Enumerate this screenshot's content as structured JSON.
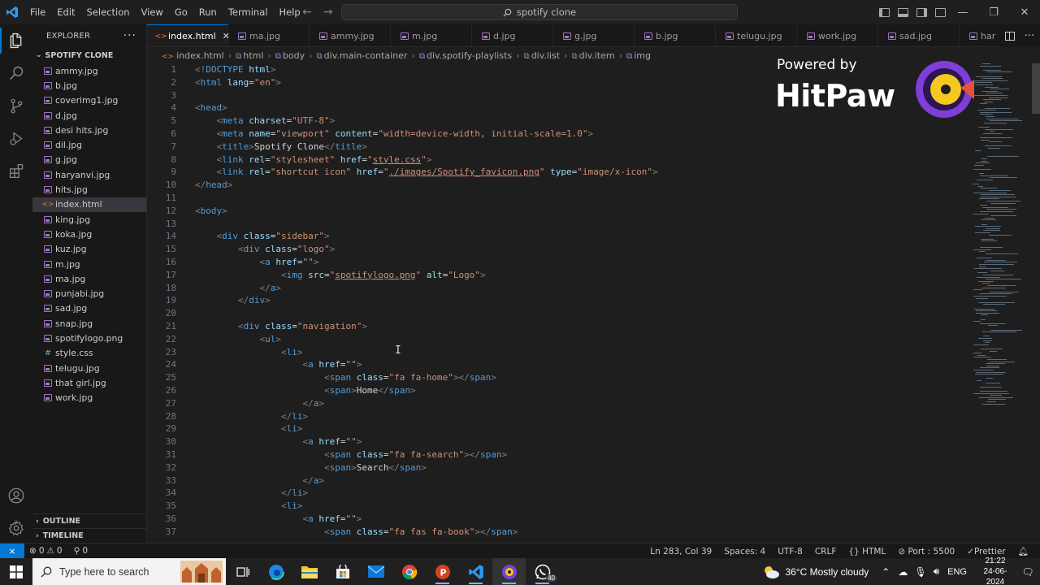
{
  "menu": [
    "File",
    "Edit",
    "Selection",
    "View",
    "Go",
    "Run",
    "Terminal",
    "Help"
  ],
  "command_center": "spotify clone",
  "explorer": {
    "title": "EXPLORER",
    "folder": "SPOTIFY CLONE",
    "files": [
      {
        "name": "ammy.jpg",
        "type": "img"
      },
      {
        "name": "b.jpg",
        "type": "img"
      },
      {
        "name": "coverimg1.jpg",
        "type": "img"
      },
      {
        "name": "d.jpg",
        "type": "img"
      },
      {
        "name": "desi hits.jpg",
        "type": "img"
      },
      {
        "name": "dil.jpg",
        "type": "img"
      },
      {
        "name": "g.jpg",
        "type": "img"
      },
      {
        "name": "haryanvi.jpg",
        "type": "img"
      },
      {
        "name": "hits.jpg",
        "type": "img"
      },
      {
        "name": "index.html",
        "type": "html",
        "active": true
      },
      {
        "name": "king.jpg",
        "type": "img"
      },
      {
        "name": "koka.jpg",
        "type": "img"
      },
      {
        "name": "kuz.jpg",
        "type": "img"
      },
      {
        "name": "m.jpg",
        "type": "img"
      },
      {
        "name": "ma.jpg",
        "type": "img"
      },
      {
        "name": "punjabi.jpg",
        "type": "img"
      },
      {
        "name": "sad.jpg",
        "type": "img"
      },
      {
        "name": "snap.jpg",
        "type": "img"
      },
      {
        "name": "spotifylogo.png",
        "type": "img"
      },
      {
        "name": "style.css",
        "type": "css"
      },
      {
        "name": "telugu.jpg",
        "type": "img"
      },
      {
        "name": "that girl.jpg",
        "type": "img"
      },
      {
        "name": "work.jpg",
        "type": "img"
      }
    ],
    "outline": "OUTLINE",
    "timeline": "TIMELINE"
  },
  "tabs": [
    {
      "name": "index.html",
      "type": "html",
      "active": true
    },
    {
      "name": "ma.jpg",
      "type": "img"
    },
    {
      "name": "ammy.jpg",
      "type": "img"
    },
    {
      "name": "m.jpg",
      "type": "img"
    },
    {
      "name": "d.jpg",
      "type": "img"
    },
    {
      "name": "g.jpg",
      "type": "img"
    },
    {
      "name": "b.jpg",
      "type": "img"
    },
    {
      "name": "telugu.jpg",
      "type": "img"
    },
    {
      "name": "work.jpg",
      "type": "img"
    },
    {
      "name": "sad.jpg",
      "type": "img"
    },
    {
      "name": "har",
      "type": "img"
    }
  ],
  "breadcrumb": [
    "index.html",
    "html",
    "body",
    "div.main-container",
    "div.spotify-playlists",
    "div.list",
    "div.item",
    "img"
  ],
  "code_lines": [
    [
      [
        "p",
        "<!"
      ],
      [
        "tag",
        "DOCTYPE"
      ],
      [
        "t",
        " "
      ],
      [
        "attr",
        "html"
      ],
      [
        "p",
        ">"
      ]
    ],
    [
      [
        "p",
        "<"
      ],
      [
        "tag",
        "html"
      ],
      [
        "t",
        " "
      ],
      [
        "attr",
        "lang"
      ],
      [
        "t",
        "="
      ],
      [
        "str",
        "\"en\""
      ],
      [
        "p",
        ">"
      ]
    ],
    [],
    [
      [
        "p",
        "<"
      ],
      [
        "tag",
        "head"
      ],
      [
        "p",
        ">"
      ]
    ],
    [
      [
        "t",
        "    "
      ],
      [
        "p",
        "<"
      ],
      [
        "tag",
        "meta"
      ],
      [
        "t",
        " "
      ],
      [
        "attr",
        "charset"
      ],
      [
        "t",
        "="
      ],
      [
        "str",
        "\"UTF-8\""
      ],
      [
        "p",
        ">"
      ]
    ],
    [
      [
        "t",
        "    "
      ],
      [
        "p",
        "<"
      ],
      [
        "tag",
        "meta"
      ],
      [
        "t",
        " "
      ],
      [
        "attr",
        "name"
      ],
      [
        "t",
        "="
      ],
      [
        "str",
        "\"viewport\""
      ],
      [
        "t",
        " "
      ],
      [
        "attr",
        "content"
      ],
      [
        "t",
        "="
      ],
      [
        "str",
        "\"width=device-width, initial-scale=1.0\""
      ],
      [
        "p",
        ">"
      ]
    ],
    [
      [
        "t",
        "    "
      ],
      [
        "p",
        "<"
      ],
      [
        "tag",
        "title"
      ],
      [
        "p",
        ">"
      ],
      [
        "t",
        "Spotify Clone"
      ],
      [
        "p",
        "</"
      ],
      [
        "tag",
        "title"
      ],
      [
        "p",
        ">"
      ]
    ],
    [
      [
        "t",
        "    "
      ],
      [
        "p",
        "<"
      ],
      [
        "tag",
        "link"
      ],
      [
        "t",
        " "
      ],
      [
        "attr",
        "rel"
      ],
      [
        "t",
        "="
      ],
      [
        "str",
        "\"stylesheet\""
      ],
      [
        "t",
        " "
      ],
      [
        "attr",
        "href"
      ],
      [
        "t",
        "="
      ],
      [
        "str",
        "\""
      ],
      [
        "strl",
        "style.css"
      ],
      [
        "str",
        "\""
      ],
      [
        "p",
        ">"
      ]
    ],
    [
      [
        "t",
        "    "
      ],
      [
        "p",
        "<"
      ],
      [
        "tag",
        "link"
      ],
      [
        "t",
        " "
      ],
      [
        "attr",
        "rel"
      ],
      [
        "t",
        "="
      ],
      [
        "str",
        "\"shortcut icon\""
      ],
      [
        "t",
        " "
      ],
      [
        "attr",
        "href"
      ],
      [
        "t",
        "="
      ],
      [
        "str",
        "\""
      ],
      [
        "strl",
        "./images/Spotify_favicon.png"
      ],
      [
        "str",
        "\""
      ],
      [
        "t",
        " "
      ],
      [
        "attr",
        "type"
      ],
      [
        "t",
        "="
      ],
      [
        "str",
        "\"image/x-icon\""
      ],
      [
        "p",
        ">"
      ]
    ],
    [
      [
        "p",
        "</"
      ],
      [
        "tag",
        "head"
      ],
      [
        "p",
        ">"
      ]
    ],
    [],
    [
      [
        "p",
        "<"
      ],
      [
        "tag",
        "body"
      ],
      [
        "p",
        ">"
      ]
    ],
    [],
    [
      [
        "t",
        "    "
      ],
      [
        "p",
        "<"
      ],
      [
        "tag",
        "div"
      ],
      [
        "t",
        " "
      ],
      [
        "attr",
        "class"
      ],
      [
        "t",
        "="
      ],
      [
        "str",
        "\"sidebar\""
      ],
      [
        "p",
        ">"
      ]
    ],
    [
      [
        "t",
        "        "
      ],
      [
        "p",
        "<"
      ],
      [
        "tag",
        "div"
      ],
      [
        "t",
        " "
      ],
      [
        "attr",
        "class"
      ],
      [
        "t",
        "="
      ],
      [
        "str",
        "\"logo\""
      ],
      [
        "p",
        ">"
      ]
    ],
    [
      [
        "t",
        "            "
      ],
      [
        "p",
        "<"
      ],
      [
        "tag",
        "a"
      ],
      [
        "t",
        " "
      ],
      [
        "attr",
        "href"
      ],
      [
        "t",
        "="
      ],
      [
        "str",
        "\"\""
      ],
      [
        "p",
        ">"
      ]
    ],
    [
      [
        "t",
        "                "
      ],
      [
        "p",
        "<"
      ],
      [
        "tag",
        "img"
      ],
      [
        "t",
        " "
      ],
      [
        "attr",
        "src"
      ],
      [
        "t",
        "="
      ],
      [
        "str",
        "\""
      ],
      [
        "strl",
        "spotifylogo.png"
      ],
      [
        "str",
        "\""
      ],
      [
        "t",
        " "
      ],
      [
        "attr",
        "alt"
      ],
      [
        "t",
        "="
      ],
      [
        "str",
        "\"Logo\""
      ],
      [
        "p",
        ">"
      ]
    ],
    [
      [
        "t",
        "            "
      ],
      [
        "p",
        "</"
      ],
      [
        "tag",
        "a"
      ],
      [
        "p",
        ">"
      ]
    ],
    [
      [
        "t",
        "        "
      ],
      [
        "p",
        "</"
      ],
      [
        "tag",
        "div"
      ],
      [
        "p",
        ">"
      ]
    ],
    [],
    [
      [
        "t",
        "        "
      ],
      [
        "p",
        "<"
      ],
      [
        "tag",
        "div"
      ],
      [
        "t",
        " "
      ],
      [
        "attr",
        "class"
      ],
      [
        "t",
        "="
      ],
      [
        "str",
        "\"navigation\""
      ],
      [
        "p",
        ">"
      ]
    ],
    [
      [
        "t",
        "            "
      ],
      [
        "p",
        "<"
      ],
      [
        "tag",
        "ul"
      ],
      [
        "p",
        ">"
      ]
    ],
    [
      [
        "t",
        "                "
      ],
      [
        "p",
        "<"
      ],
      [
        "tag",
        "li"
      ],
      [
        "p",
        ">"
      ]
    ],
    [
      [
        "t",
        "                    "
      ],
      [
        "p",
        "<"
      ],
      [
        "tag",
        "a"
      ],
      [
        "t",
        " "
      ],
      [
        "attr",
        "href"
      ],
      [
        "t",
        "="
      ],
      [
        "str",
        "\"\""
      ],
      [
        "p",
        ">"
      ]
    ],
    [
      [
        "t",
        "                        "
      ],
      [
        "p",
        "<"
      ],
      [
        "tag",
        "span"
      ],
      [
        "t",
        " "
      ],
      [
        "attr",
        "class"
      ],
      [
        "t",
        "="
      ],
      [
        "str",
        "\"fa fa-home\""
      ],
      [
        "p",
        "></"
      ],
      [
        "tag",
        "span"
      ],
      [
        "p",
        ">"
      ]
    ],
    [
      [
        "t",
        "                        "
      ],
      [
        "p",
        "<"
      ],
      [
        "tag",
        "span"
      ],
      [
        "p",
        ">"
      ],
      [
        "t",
        "Home"
      ],
      [
        "p",
        "</"
      ],
      [
        "tag",
        "span"
      ],
      [
        "p",
        ">"
      ]
    ],
    [
      [
        "t",
        "                    "
      ],
      [
        "p",
        "</"
      ],
      [
        "tag",
        "a"
      ],
      [
        "p",
        ">"
      ]
    ],
    [
      [
        "t",
        "                "
      ],
      [
        "p",
        "</"
      ],
      [
        "tag",
        "li"
      ],
      [
        "p",
        ">"
      ]
    ],
    [
      [
        "t",
        "                "
      ],
      [
        "p",
        "<"
      ],
      [
        "tag",
        "li"
      ],
      [
        "p",
        ">"
      ]
    ],
    [
      [
        "t",
        "                    "
      ],
      [
        "p",
        "<"
      ],
      [
        "tag",
        "a"
      ],
      [
        "t",
        " "
      ],
      [
        "attr",
        "href"
      ],
      [
        "t",
        "="
      ],
      [
        "str",
        "\"\""
      ],
      [
        "p",
        ">"
      ]
    ],
    [
      [
        "t",
        "                        "
      ],
      [
        "p",
        "<"
      ],
      [
        "tag",
        "span"
      ],
      [
        "t",
        " "
      ],
      [
        "attr",
        "class"
      ],
      [
        "t",
        "="
      ],
      [
        "str",
        "\"fa fa-search\""
      ],
      [
        "p",
        "></"
      ],
      [
        "tag",
        "span"
      ],
      [
        "p",
        ">"
      ]
    ],
    [
      [
        "t",
        "                        "
      ],
      [
        "p",
        "<"
      ],
      [
        "tag",
        "span"
      ],
      [
        "p",
        ">"
      ],
      [
        "t",
        "Search"
      ],
      [
        "p",
        "</"
      ],
      [
        "tag",
        "span"
      ],
      [
        "p",
        ">"
      ]
    ],
    [
      [
        "t",
        "                    "
      ],
      [
        "p",
        "</"
      ],
      [
        "tag",
        "a"
      ],
      [
        "p",
        ">"
      ]
    ],
    [
      [
        "t",
        "                "
      ],
      [
        "p",
        "</"
      ],
      [
        "tag",
        "li"
      ],
      [
        "p",
        ">"
      ]
    ],
    [
      [
        "t",
        "                "
      ],
      [
        "p",
        "<"
      ],
      [
        "tag",
        "li"
      ],
      [
        "p",
        ">"
      ]
    ],
    [
      [
        "t",
        "                    "
      ],
      [
        "p",
        "<"
      ],
      [
        "tag",
        "a"
      ],
      [
        "t",
        " "
      ],
      [
        "attr",
        "href"
      ],
      [
        "t",
        "="
      ],
      [
        "str",
        "\"\""
      ],
      [
        "p",
        ">"
      ]
    ],
    [
      [
        "t",
        "                        "
      ],
      [
        "p",
        "<"
      ],
      [
        "tag",
        "span"
      ],
      [
        "t",
        " "
      ],
      [
        "attr",
        "class"
      ],
      [
        "t",
        "="
      ],
      [
        "str",
        "\"fa fas fa-book\""
      ],
      [
        "p",
        "></"
      ],
      [
        "tag",
        "span"
      ],
      [
        "p",
        ">"
      ]
    ]
  ],
  "watermark": {
    "powered": "Powered by",
    "name": "HitPaw"
  },
  "status": {
    "errors": "0",
    "warnings": "0",
    "ports_count": "0",
    "position": "Ln 283, Col 39",
    "spaces": "Spaces: 4",
    "encoding": "UTF-8",
    "eol": "CRLF",
    "language": "HTML",
    "port": "Port : 5500",
    "prettier": "Prettier"
  },
  "taskbar": {
    "search_placeholder": "Type here to search",
    "whatsapp_badge": "40",
    "weather": "36°C  Mostly cloudy",
    "lang": "ENG",
    "time": "21:22",
    "date": "24-06-2024"
  },
  "colors": {
    "accent": "#0078d4",
    "tag": "#569cd6",
    "attr": "#9cdcfe",
    "string": "#ce9178"
  }
}
